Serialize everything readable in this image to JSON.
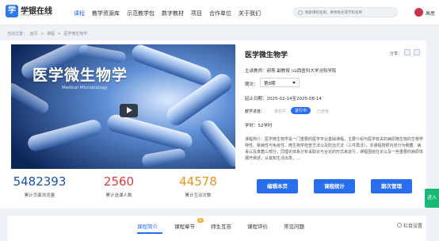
{
  "header": {
    "logo_mark": "学",
    "logo_name": "学银在线",
    "logo_sub": "xueyinonline.com",
    "nav": [
      "课程",
      "教学资源库",
      "示范教学包",
      "数字教材",
      "项目",
      "合作单位",
      "关于我们"
    ],
    "active_nav": "课程",
    "search_placeholder": "搜索课程名称、教师姓名或学校名称",
    "username": "高思"
  },
  "breadcrumb": [
    "当前位置：",
    "首页",
    ">",
    "课程",
    ">",
    "医学微生物学"
  ],
  "video": {
    "title": "医学微生物学",
    "subtitle": "Medical Microbiology"
  },
  "stats": [
    {
      "value": "5482393",
      "label": "累计页面浏览量",
      "color": "#1f4fa8"
    },
    {
      "value": "2560",
      "label": "累计选课人数",
      "color": "#e23a3a"
    },
    {
      "value": "44578",
      "label": "累计互动次数",
      "color": "#e8921c"
    }
  ],
  "course": {
    "title": "医学微生物学",
    "share_label": "分享：",
    "teacher": "主讲教师：郝燕 副教授 /山西医科大学汾阳学院",
    "term_label": "期次：",
    "term_value": "第8期",
    "dates": "起止日期：2025-02-14至2025-08-14",
    "progress_label": "教学进度：",
    "progress_steps": [
      "报名中",
      "进行中",
      "已结束"
    ],
    "hours": "学时：52学时",
    "intro": "课程简介：医学微生物学是一门重要的医学专业基础课程，主要介绍与医学有关的病原微生物的生物学特性、致病性与免疫性、微生物学检查方法以及防治方法（三件再法），本课程按照内容分为细菌、病毒以及真菌三部分，同理论体系分析采取论与合论的形式来进行，课程围绕在论以及一些重要的病原体展开阐述，从其知生活出发，..."
  },
  "buttons": [
    "编辑本页",
    "课程统计",
    "期次管理"
  ],
  "side_tab": "进入",
  "tabs": [
    "课程简介",
    "课程章节",
    "师生互答",
    "课程评价",
    "常见问题"
  ],
  "tab_badge": "新",
  "settings_label": "栏目设置",
  "colors": {
    "accent": "#2a6ef0",
    "join": "#19b876"
  }
}
